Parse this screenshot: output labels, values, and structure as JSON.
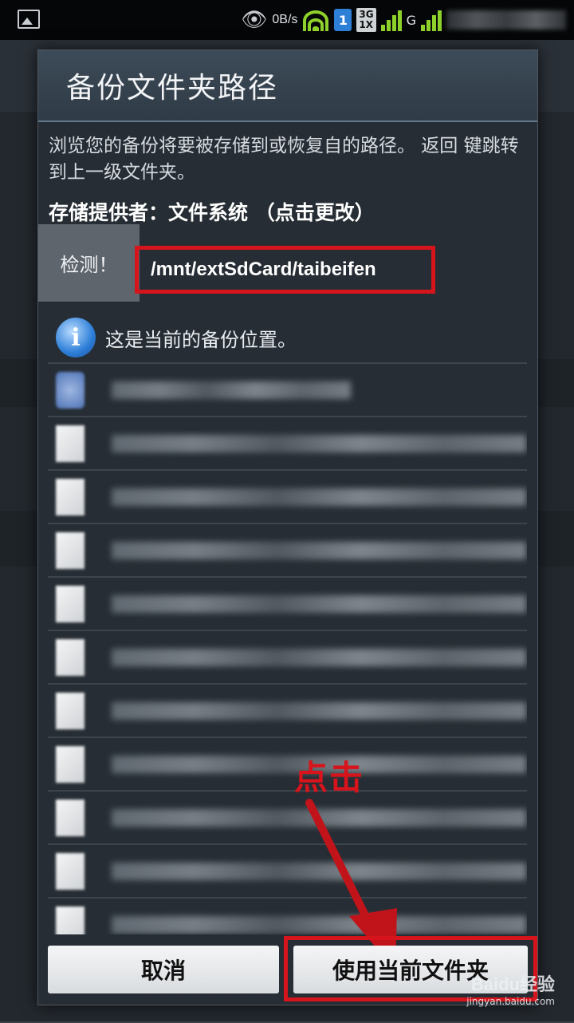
{
  "status_bar": {
    "network_speed": "0B/s",
    "sim_badge": "1",
    "network_type": "3G\n1X",
    "signal_label": "G"
  },
  "dialog": {
    "title": "备份文件夹路径",
    "description": "浏览您的备份将要被存储到或恢复自的路径。 返回 键跳转到上一级文件夹。",
    "provider_label": "存储提供者：文件系统 （点击更改）",
    "detect_button": "检测！",
    "current_path": "/mnt/extSdCard/taibeifen",
    "info_text": "这是当前的备份位置。",
    "cancel_button": "取消",
    "use_button": "使用当前文件夹"
  },
  "annotation": {
    "label": "点击",
    "color": "#d6141b"
  },
  "watermark": {
    "main": "Baidu经验",
    "sub": "jingyan.baidu.com"
  },
  "colors": {
    "accent_red": "#d6141b",
    "dialog_bg": "#262d34",
    "title_bg": "#3d4b58"
  }
}
